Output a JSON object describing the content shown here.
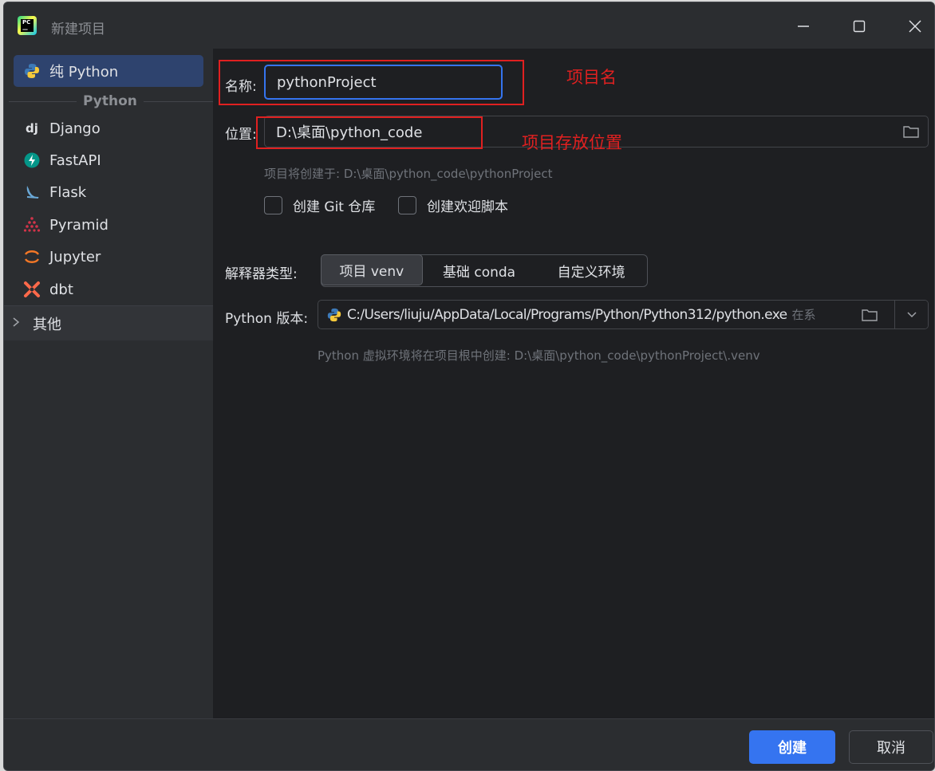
{
  "window": {
    "title": "新建项目"
  },
  "sidebar": {
    "items": [
      {
        "label": "纯 Python",
        "icon": "python-icon"
      },
      {
        "label": "Django",
        "icon": "django-icon"
      },
      {
        "label": "FastAPI",
        "icon": "fastapi-icon"
      },
      {
        "label": "Flask",
        "icon": "flask-icon"
      },
      {
        "label": "Pyramid",
        "icon": "pyramid-icon"
      },
      {
        "label": "Jupyter",
        "icon": "jupyter-icon"
      },
      {
        "label": "dbt",
        "icon": "dbt-icon"
      }
    ],
    "group_label": "Python",
    "other_label": "其他"
  },
  "form": {
    "name_label": "名称:",
    "name_value": "pythonProject",
    "location_label": "位置:",
    "location_value": "D:\\桌面\\python_code",
    "create_hint": "项目将创建于: D:\\桌面\\python_code\\pythonProject",
    "git_checkbox_label": "创建 Git 仓库",
    "welcome_checkbox_label": "创建欢迎脚本",
    "interpreter_label": "解释器类型:",
    "interpreter_options": [
      "项目 venv",
      "基础 conda",
      "自定义环境"
    ],
    "interpreter_selected": "项目 venv",
    "python_version_label": "Python 版本:",
    "python_version_value": "C:/Users/liuju/AppData/Local/Programs/Python/Python312/python.exe",
    "python_version_suffix": "在系",
    "venv_hint": "Python 虚拟环境将在项目根中创建: D:\\桌面\\python_code\\pythonProject\\.venv"
  },
  "annotations": {
    "project_name": "项目名",
    "project_location": "项目存放位置"
  },
  "footer": {
    "create_button": "创建",
    "cancel_button": "取消"
  },
  "colors": {
    "accent": "#3574f0",
    "annotation": "#e02020",
    "selected_sidebar": "#2e436e"
  }
}
